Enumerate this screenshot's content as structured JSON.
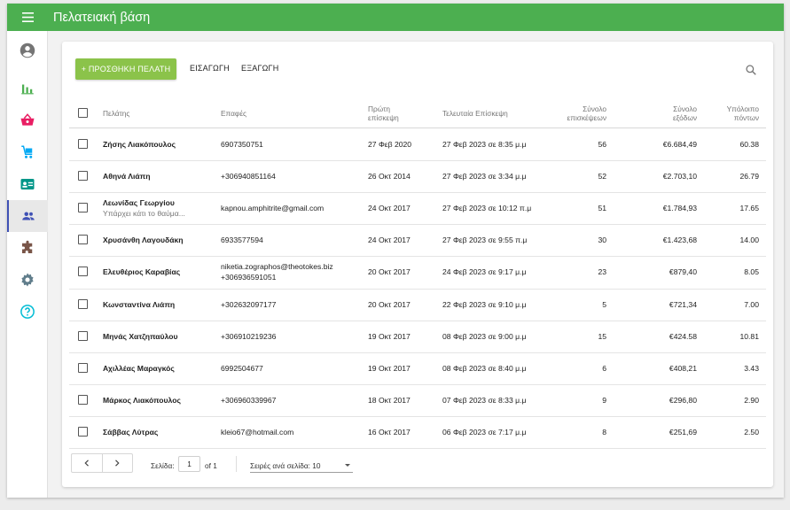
{
  "app": {
    "title": "Πελατειακή βάση"
  },
  "colors": {
    "header": "#4caf50",
    "add_button": "#8bc34a",
    "active_indicator": "#3f51b5"
  },
  "sidebar": {
    "items": [
      {
        "icon": "account-circle-icon"
      },
      {
        "icon": "bar-chart-icon",
        "color": "#4caf50"
      },
      {
        "icon": "basket-icon",
        "color": "#e91e63"
      },
      {
        "icon": "cart-icon",
        "color": "#03a9f4"
      },
      {
        "icon": "contact-card-icon",
        "color": "#009688"
      },
      {
        "icon": "people-icon",
        "color": "#3f51b5",
        "active": true
      },
      {
        "icon": "puzzle-icon",
        "color": "#795548"
      },
      {
        "icon": "gear-icon",
        "color": "#607d8b"
      },
      {
        "icon": "help-icon",
        "color": "#00bcd4"
      }
    ]
  },
  "toolbar": {
    "add_label": "+ ΠΡΟΣΘΗΚΗ ΠΕΛΑΤΗ",
    "import_label": "ΕΙΣΑΓΩΓΗ",
    "export_label": "ΕΞΑΓΩΓΗ"
  },
  "table": {
    "headers": {
      "customer": "Πελάτης",
      "contacts": "Επαφές",
      "first_visit_1": "Πρώτη",
      "first_visit_2": "επίσκεψη",
      "last_visit": "Τελευταία Επίσκεψη",
      "total_visits_1": "Σύνολο",
      "total_visits_2": "επισκέψεων",
      "total_spend_1": "Σύνολο",
      "total_spend_2": "εξόδων",
      "points_1": "Υπόλοιπο",
      "points_2": "πόντων"
    },
    "rows": [
      {
        "name": "Ζήσης Λιακόπουλος",
        "contact1": "6907350751",
        "first": "27 Φεβ 2020",
        "last": "27 Φεβ 2023 σε 8:35 μ.μ",
        "visits": "56",
        "spend": "€6.684,49",
        "points": "60.38"
      },
      {
        "name": "Αθηνά Λιάπη",
        "contact1": "+306940851164",
        "first": "26 Οκτ 2014",
        "last": "27 Φεβ 2023 σε 3:34 μ.μ",
        "visits": "52",
        "spend": "€2.703,10",
        "points": "26.79"
      },
      {
        "name": "Λεωνίδας Γεωργίου",
        "note": "Υπάρχει κάτι το θαύμα...",
        "contact1": "kapnou.amphitrite@gmail.com",
        "first": "24 Οκτ 2017",
        "last": "27 Φεβ 2023 σε 10:12 π.μ",
        "visits": "51",
        "spend": "€1.784,93",
        "points": "17.65"
      },
      {
        "name": "Χρυσάνθη Λαγουδάκη",
        "contact1": "6933577594",
        "first": "24 Οκτ 2017",
        "last": "27 Φεβ 2023 σε 9:55 π.μ",
        "visits": "30",
        "spend": "€1.423,68",
        "points": "14.00"
      },
      {
        "name": "Ελευθέριος Καραβίας",
        "contact1": "niketia.zographos@theotokes.biz",
        "contact2": "+306936591051",
        "first": "20 Οκτ 2017",
        "last": "24 Φεβ 2023 σε 9:17 μ.μ",
        "visits": "23",
        "spend": "€879,40",
        "points": "8.05"
      },
      {
        "name": "Κωνσταντίνα Λιάπη",
        "contact1": "+302632097177",
        "first": "20 Οκτ 2017",
        "last": "22 Φεβ 2023 σε 9:10 μ.μ",
        "visits": "5",
        "spend": "€721,34",
        "points": "7.00"
      },
      {
        "name": "Μηνάς Χατζηπαύλου",
        "contact1": "+306910219236",
        "first": "19 Οκτ 2017",
        "last": "08 Φεβ 2023 σε 9:00 μ.μ",
        "visits": "15",
        "spend": "€424.58",
        "points": "10.81"
      },
      {
        "name": "Αχιλλέας Μαραγκός",
        "contact1": "6992504677",
        "first": "19 Οκτ 2017",
        "last": "08 Φεβ 2023 σε 8:40 μ.μ",
        "visits": "6",
        "spend": "€408,21",
        "points": "3.43"
      },
      {
        "name": "Μάρκος Λιακόπουλος",
        "contact1": "+306960339967",
        "first": "18 Οκτ 2017",
        "last": "07 Φεβ 2023 σε 8:33 μ.μ",
        "visits": "9",
        "spend": "€296,80",
        "points": "2.90"
      },
      {
        "name": "Σάββας Λύτρας",
        "contact1": "kleio67@hotmail.com",
        "first": "16 Οκτ 2017",
        "last": "06 Φεβ 2023 σε 7:17 μ.μ",
        "visits": "8",
        "spend": "€251,69",
        "points": "2.50"
      }
    ]
  },
  "pagination": {
    "page_label": "Σελίδα:",
    "page_value": "1",
    "of_label": "of 1",
    "rows_per_page": "Σειρές ανά σελίδα: 10"
  }
}
